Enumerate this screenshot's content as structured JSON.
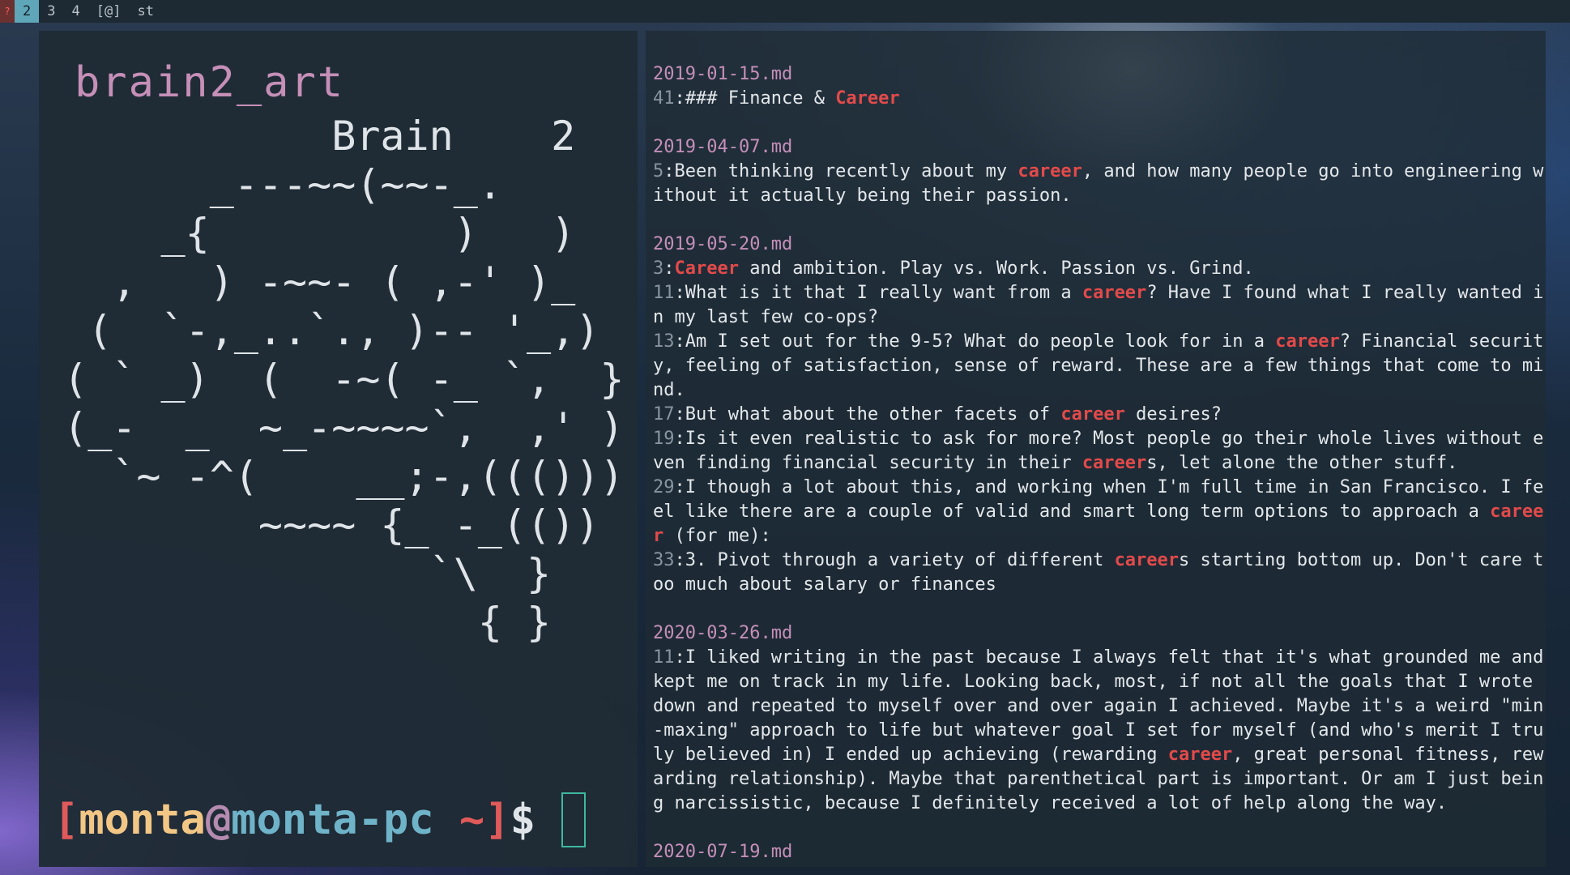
{
  "topbar": {
    "urgent_indicator": "?",
    "workspaces": [
      "2",
      "3",
      "4",
      "[@]"
    ],
    "active_workspace": "2",
    "window_title": "st"
  },
  "left_terminal": {
    "art_title": "brain2_art",
    "art_lines": [
      "            Brain    2",
      "       _---~~(~~-_.",
      "     _{          )   )",
      "   ,   ) -~~- ( ,-' )_",
      "  (  `-,_..`., )-- '_,)",
      " ( ` _)  (  -~( -_ `,  }",
      " (_-  _  ~_-~~~~`,  ,' )",
      "   `~ -^(    __;-,((()))",
      "         ~~~~ {_ -_(())",
      "                `\\  }",
      "                  { }"
    ],
    "prompt": {
      "open_bracket": "[",
      "user": "monta",
      "at": "@",
      "host": "monta-pc",
      "path": " ~",
      "close_bracket": "]",
      "symbol": "$"
    }
  },
  "search": {
    "highlight_color": "#e24a4a",
    "results": [
      {
        "file": "2019-01-15.md",
        "matches": [
          {
            "line": "41",
            "parts": [
              {
                "t": "### Finance & "
              },
              {
                "t": "Career",
                "hl": true
              }
            ]
          }
        ]
      },
      {
        "file": "2019-04-07.md",
        "matches": [
          {
            "line": "5",
            "parts": [
              {
                "t": "Been thinking recently about my "
              },
              {
                "t": "career",
                "hl": true
              },
              {
                "t": ", and how many people go into engineering without it actually being their passion."
              }
            ]
          }
        ]
      },
      {
        "file": "2019-05-20.md",
        "matches": [
          {
            "line": "3",
            "parts": [
              {
                "t": "Career",
                "hl": true
              },
              {
                "t": " and ambition. Play vs. Work. Passion vs. Grind."
              }
            ]
          },
          {
            "line": "11",
            "parts": [
              {
                "t": "What is it that I really want from a "
              },
              {
                "t": "career",
                "hl": true
              },
              {
                "t": "? Have I found what I really wanted in my last few co-ops?"
              }
            ]
          },
          {
            "line": "13",
            "parts": [
              {
                "t": "Am I set out for the 9-5? What do people look for in a "
              },
              {
                "t": "career",
                "hl": true
              },
              {
                "t": "? Financial security, feeling of satisfaction, sense of reward. These are a few things that come to mind."
              }
            ]
          },
          {
            "line": "17",
            "parts": [
              {
                "t": "But what about the other facets of "
              },
              {
                "t": "career",
                "hl": true
              },
              {
                "t": " desires?"
              }
            ]
          },
          {
            "line": "19",
            "parts": [
              {
                "t": "Is it even realistic to ask for more? Most people go their whole lives without even finding financial security in their "
              },
              {
                "t": "career",
                "hl": true
              },
              {
                "t": "s, let alone the other stuff."
              }
            ]
          },
          {
            "line": "29",
            "parts": [
              {
                "t": "I though a lot about this, and working when I'm full time in San Francisco. I feel like there are a couple of valid and smart long term options to approach a "
              },
              {
                "t": "career",
                "hl": true
              },
              {
                "t": " (for me):"
              }
            ]
          },
          {
            "line": "33",
            "parts": [
              {
                "t": "3. Pivot through a variety of different "
              },
              {
                "t": "career",
                "hl": true
              },
              {
                "t": "s starting bottom up. Don't care too much about salary or finances"
              }
            ]
          }
        ]
      },
      {
        "file": "2020-03-26.md",
        "matches": [
          {
            "line": "11",
            "parts": [
              {
                "t": "I liked writing in the past because I always felt that it's what grounded me and kept me on track in my life. Looking back, most, if not all the goals that I wrote down and repeated to myself over and over again I achieved. Maybe it's a weird \"min-maxing\" approach to life but whatever goal I set for myself (and who's merit I truly believed in) I ended up achieving (rewarding "
              },
              {
                "t": "career",
                "hl": true
              },
              {
                "t": ", great personal fitness, rewarding relationship). Maybe that parenthetical part is important. Or am I just being narcissistic, because I definitely received a lot of help along the way."
              }
            ]
          }
        ]
      },
      {
        "file": "2020-07-19.md",
        "matches": []
      }
    ]
  }
}
